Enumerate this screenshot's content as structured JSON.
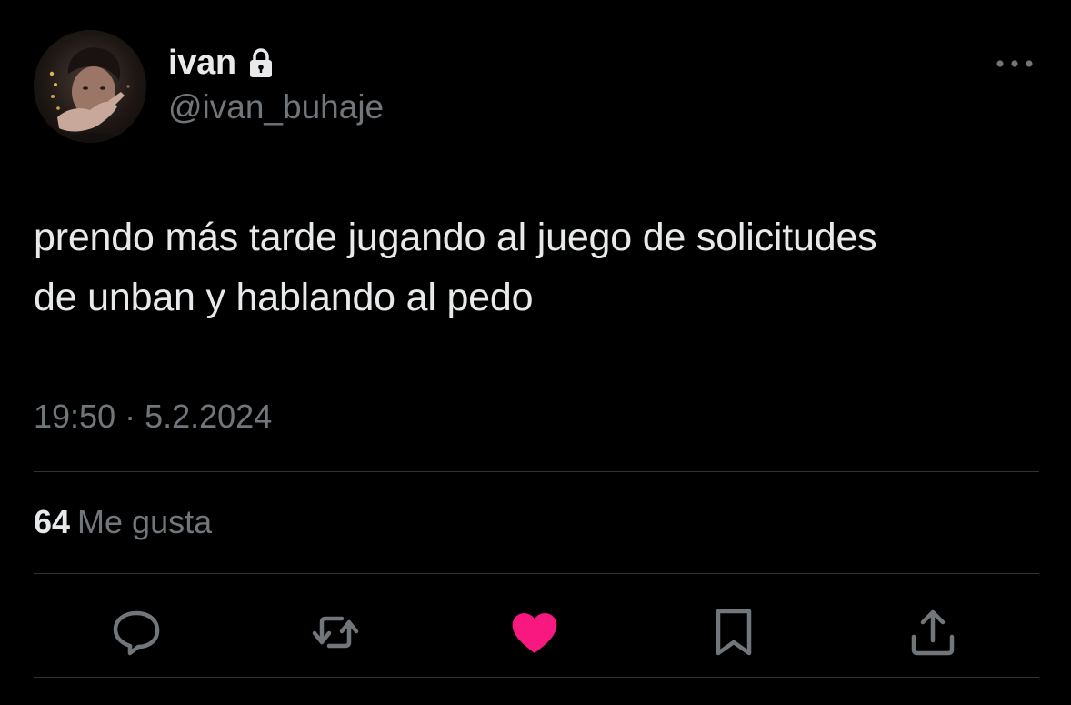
{
  "user": {
    "display_name": "ivan",
    "handle": "@ivan_buhaje",
    "protected_icon": "lock-icon",
    "avatar": "profile-photo"
  },
  "tweet": {
    "text_line1": "prendo más tarde jugando al juego de solicitudes",
    "text_line2": "de unban y hablando al pedo",
    "timestamp": "19:50 · 5.2.2024"
  },
  "stats": {
    "likes_count": "64",
    "likes_label": "Me gusta"
  },
  "actions": {
    "reply_icon": "reply-icon",
    "retweet_icon": "retweet-icon",
    "like_icon": "heart-icon",
    "bookmark_icon": "bookmark-icon",
    "share_icon": "share-icon",
    "liked": true
  },
  "colors": {
    "background": "#000000",
    "primary_text": "#e7e9ea",
    "secondary_text": "#71767b",
    "divider": "#2f3336",
    "like_active": "#f91880"
  }
}
